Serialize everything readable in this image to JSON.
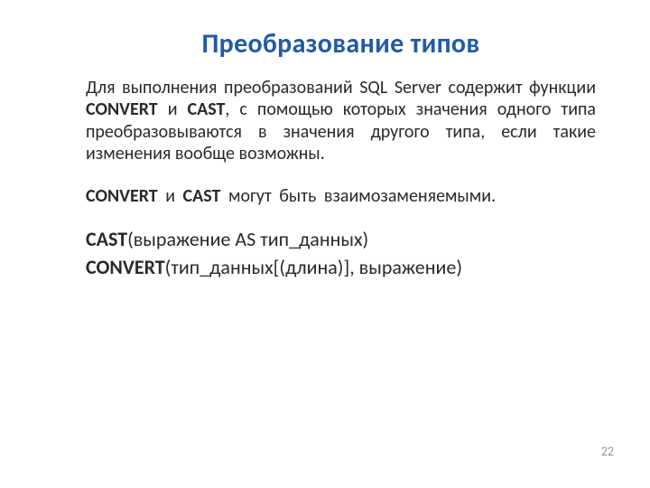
{
  "title": "Преобразование типов",
  "para1": {
    "t1": "Для выполнения преобразований SQL Server содержит функции ",
    "b1": "CONVERT",
    "t2": " и ",
    "b2": "CAST",
    "t3": ", с помощью которых значения одного типа преобразовываются в значения другого типа, если такие изменения вообще возможны."
  },
  "para2": {
    "b1": "CONVERT",
    "t1": " и ",
    "b2": "CAST",
    "t2": " могут быть взаимозаменяемыми."
  },
  "syntax1": {
    "b1": "CAST",
    "t1": "(выражение AS тип_данных)"
  },
  "syntax2": {
    "b1": "CONVERT",
    "t1": "(тип_данных[(длина)], выражение)"
  },
  "page_number": "22"
}
